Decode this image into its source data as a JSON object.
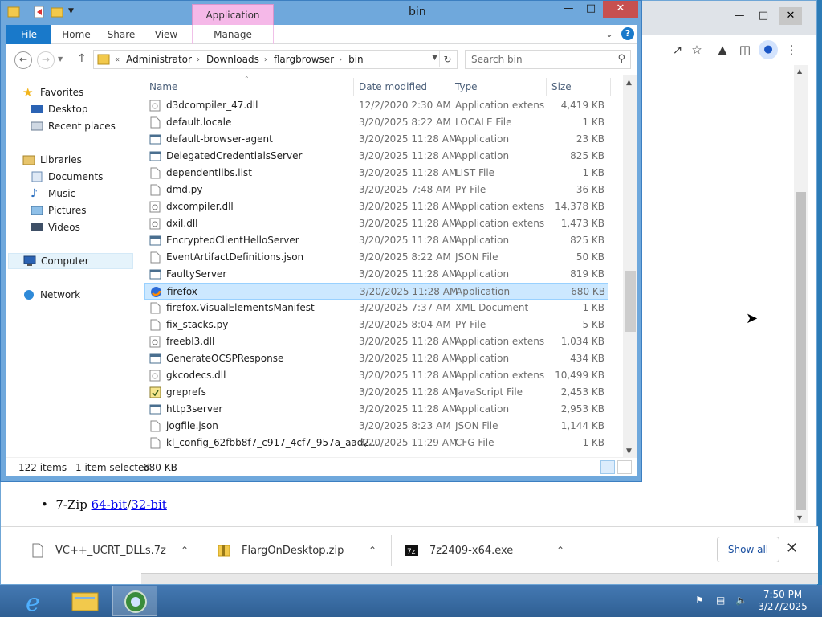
{
  "explorer": {
    "title": "bin",
    "context_tab": "Application Tools",
    "ribbon_tabs": [
      "File",
      "Home",
      "Share",
      "View",
      "Manage"
    ],
    "path": [
      "Administrator",
      "Downloads",
      "flargbrowser",
      "bin"
    ],
    "path_prefix": "«",
    "search_placeholder": "Search bin",
    "columns": [
      "Name",
      "Date modified",
      "Type",
      "Size"
    ],
    "nav": {
      "favorites": "Favorites",
      "desktop": "Desktop",
      "recent": "Recent places",
      "libraries": "Libraries",
      "documents": "Documents",
      "music": "Music",
      "pictures": "Pictures",
      "videos": "Videos",
      "computer": "Computer",
      "network": "Network"
    },
    "files": [
      {
        "name": "d3dcompiler_47.dll",
        "date": "12/2/2020 2:30 AM",
        "type": "Application extens...",
        "size": "4,419 KB",
        "icon": "dll"
      },
      {
        "name": "default.locale",
        "date": "3/20/2025 8:22 AM",
        "type": "LOCALE File",
        "size": "1 KB",
        "icon": "file"
      },
      {
        "name": "default-browser-agent",
        "date": "3/20/2025 11:28 AM",
        "type": "Application",
        "size": "23 KB",
        "icon": "app"
      },
      {
        "name": "DelegatedCredentialsServer",
        "date": "3/20/2025 11:28 AM",
        "type": "Application",
        "size": "825 KB",
        "icon": "app"
      },
      {
        "name": "dependentlibs.list",
        "date": "3/20/2025 11:28 AM",
        "type": "LIST File",
        "size": "1 KB",
        "icon": "file"
      },
      {
        "name": "dmd.py",
        "date": "3/20/2025 7:48 AM",
        "type": "PY File",
        "size": "36 KB",
        "icon": "file"
      },
      {
        "name": "dxcompiler.dll",
        "date": "3/20/2025 11:28 AM",
        "type": "Application extens...",
        "size": "14,378 KB",
        "icon": "dll"
      },
      {
        "name": "dxil.dll",
        "date": "3/20/2025 11:28 AM",
        "type": "Application extens...",
        "size": "1,473 KB",
        "icon": "dll"
      },
      {
        "name": "EncryptedClientHelloServer",
        "date": "3/20/2025 11:28 AM",
        "type": "Application",
        "size": "825 KB",
        "icon": "app"
      },
      {
        "name": "EventArtifactDefinitions.json",
        "date": "3/20/2025 8:22 AM",
        "type": "JSON File",
        "size": "50 KB",
        "icon": "file"
      },
      {
        "name": "FaultyServer",
        "date": "3/20/2025 11:28 AM",
        "type": "Application",
        "size": "819 KB",
        "icon": "app"
      },
      {
        "name": "firefox",
        "date": "3/20/2025 11:28 AM",
        "type": "Application",
        "size": "680 KB",
        "icon": "firefox",
        "selected": true
      },
      {
        "name": "firefox.VisualElementsManifest",
        "date": "3/20/2025 7:37 AM",
        "type": "XML Document",
        "size": "1 KB",
        "icon": "file"
      },
      {
        "name": "fix_stacks.py",
        "date": "3/20/2025 8:04 AM",
        "type": "PY File",
        "size": "5 KB",
        "icon": "file"
      },
      {
        "name": "freebl3.dll",
        "date": "3/20/2025 11:28 AM",
        "type": "Application extens...",
        "size": "1,034 KB",
        "icon": "dll"
      },
      {
        "name": "GenerateOCSPResponse",
        "date": "3/20/2025 11:28 AM",
        "type": "Application",
        "size": "434 KB",
        "icon": "app"
      },
      {
        "name": "gkcodecs.dll",
        "date": "3/20/2025 11:28 AM",
        "type": "Application extens...",
        "size": "10,499 KB",
        "icon": "dll"
      },
      {
        "name": "greprefs",
        "date": "3/20/2025 11:28 AM",
        "type": "JavaScript File",
        "size": "2,453 KB",
        "icon": "js"
      },
      {
        "name": "http3server",
        "date": "3/20/2025 11:28 AM",
        "type": "Application",
        "size": "2,953 KB",
        "icon": "app"
      },
      {
        "name": "jogfile.json",
        "date": "3/20/2025 8:23 AM",
        "type": "JSON File",
        "size": "1,144 KB",
        "icon": "file"
      },
      {
        "name": "kl_config_62fbb8f7_c917_4cf7_957a_aad2...",
        "date": "3/20/2025 11:29 AM",
        "type": "CFG File",
        "size": "1 KB",
        "icon": "file"
      }
    ],
    "status": {
      "items": "122 items",
      "selected": "1 item selected",
      "selected_size": "680 KB"
    }
  },
  "browser": {
    "page_bullet_prefix": "7-Zip ",
    "link_64": "64-bit",
    "link_sep": "/",
    "link_32": "32-bit",
    "downloads": [
      {
        "name": "VC++_UCRT_DLLs.7z"
      },
      {
        "name": "FlargOnDesktop.zip"
      },
      {
        "name": "7z2409-x64.exe"
      }
    ],
    "show_all": "Show all"
  },
  "taskbar": {
    "time": "7:50 PM",
    "date": "3/27/2025"
  },
  "colors": {
    "ribbon_file": "#1979ca",
    "selected_row": "#cce8ff",
    "context_tab": "#f5b8e8",
    "close_button": "#c75050"
  }
}
